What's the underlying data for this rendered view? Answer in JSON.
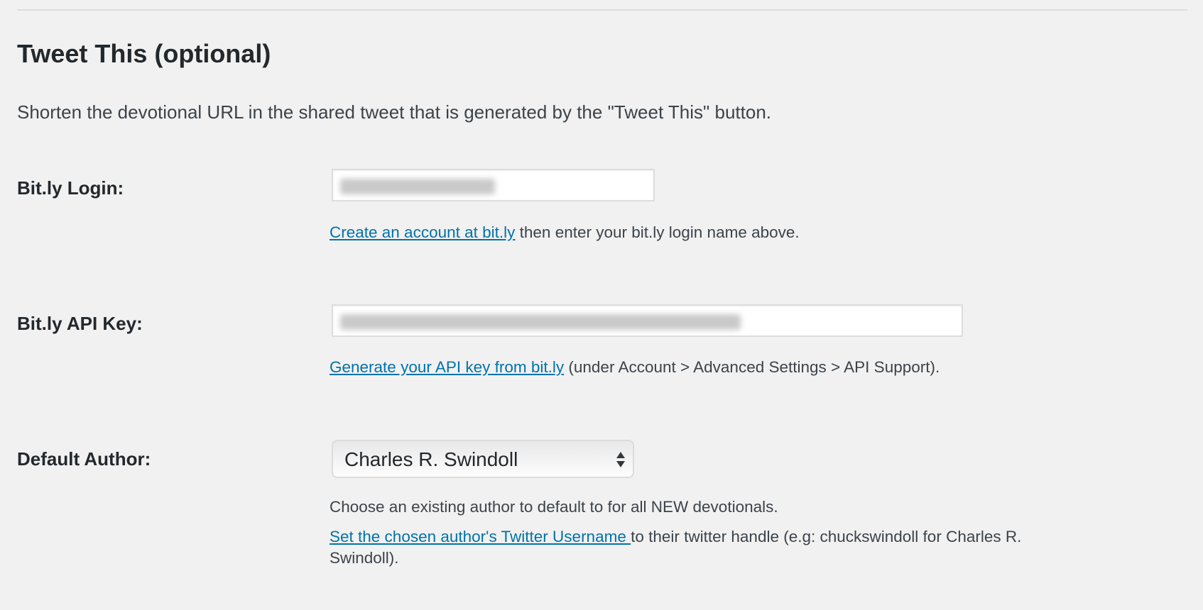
{
  "section": {
    "title": "Tweet This (optional)",
    "description": "Shorten the devotional URL in the shared tweet that is generated by the \"Tweet This\" button."
  },
  "fields": {
    "login": {
      "label": "Bit.ly Login:",
      "help_link": "Create an account at bit.ly",
      "help_text": " then enter your bit.ly login name above."
    },
    "api_key": {
      "label": "Bit.ly API Key:",
      "help_link": "Generate your API key from bit.ly",
      "help_text": " (under Account > Advanced Settings > API Support)."
    },
    "author": {
      "label": "Default Author:",
      "selected": "Charles R. Swindoll",
      "help_line1": "Choose an existing author to default to for all NEW devotionals.",
      "help_link": "Set the chosen author's Twitter Username ",
      "help_text": "to their twitter handle (e.g: chuckswindoll for Charles R.",
      "help_text_cont": "Swindoll)."
    }
  },
  "colors": {
    "link": "#0073aa",
    "text": "#23282d",
    "background": "#f1f1f1"
  }
}
